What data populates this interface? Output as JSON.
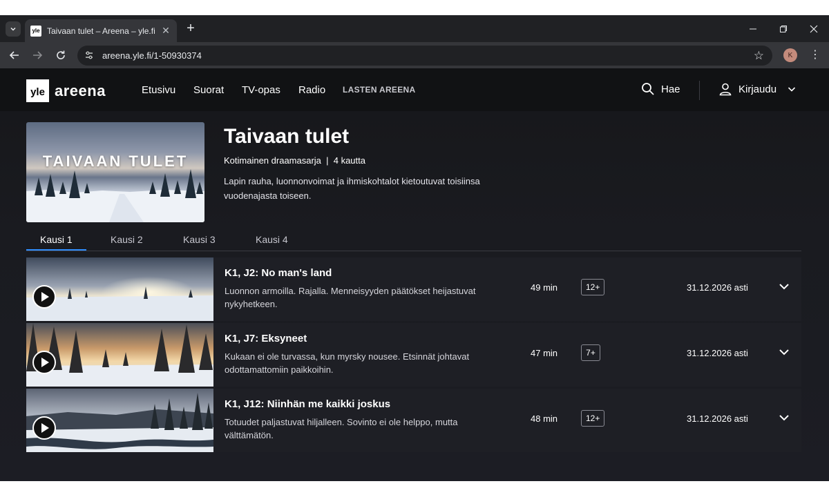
{
  "browser": {
    "tab_title": "Taivaan tulet – Areena – yle.fi",
    "favicon_text": "yle",
    "url": "areena.yle.fi/1-50930374",
    "profile_initial": "K"
  },
  "header": {
    "logo_box": "yle",
    "logo_text": "areena",
    "nav": [
      "Etusivu",
      "Suorat",
      "TV-opas",
      "Radio",
      "LASTEN AREENA"
    ],
    "search_label": "Hae",
    "login_label": "Kirjaudu"
  },
  "show": {
    "image_text": "TAIVAAN TULET",
    "title": "Taivaan tulet",
    "meta": "Kotimainen draamasarja  |  4 kautta",
    "description": "Lapin rauha, luonnonvoimat ja ihmiskohtalot kietoutuvat toisiinsa vuodenajasta toiseen."
  },
  "seasons": [
    "Kausi 1",
    "Kausi 2",
    "Kausi 3",
    "Kausi 4"
  ],
  "episodes": [
    {
      "title": "K1, J2: No man's land",
      "description": "Luonnon armoilla. Rajalla. Menneisyyden päätökset heijastuvat nykyhetkeen.",
      "duration": "49 min",
      "age": "12+",
      "available": "31.12.2026 asti"
    },
    {
      "title": "K1, J7: Eksyneet",
      "description": "Kukaan ei ole turvassa, kun myrsky nousee. Etsinnät johtavat odottamattomiin paikkoihin.",
      "duration": "47 min",
      "age": "7+",
      "available": "31.12.2026 asti"
    },
    {
      "title": "K1, J12: Niinhän me kaikki joskus",
      "description": "Totuudet paljastuvat hiljalleen. Sovinto ei ole helppo, mutta välttämätön.",
      "duration": "48 min",
      "age": "12+",
      "available": "31.12.2026 asti"
    }
  ],
  "colors": {
    "accent": "#2f8fff",
    "page_bg": "#1a1b20",
    "header_bg": "#111214"
  }
}
